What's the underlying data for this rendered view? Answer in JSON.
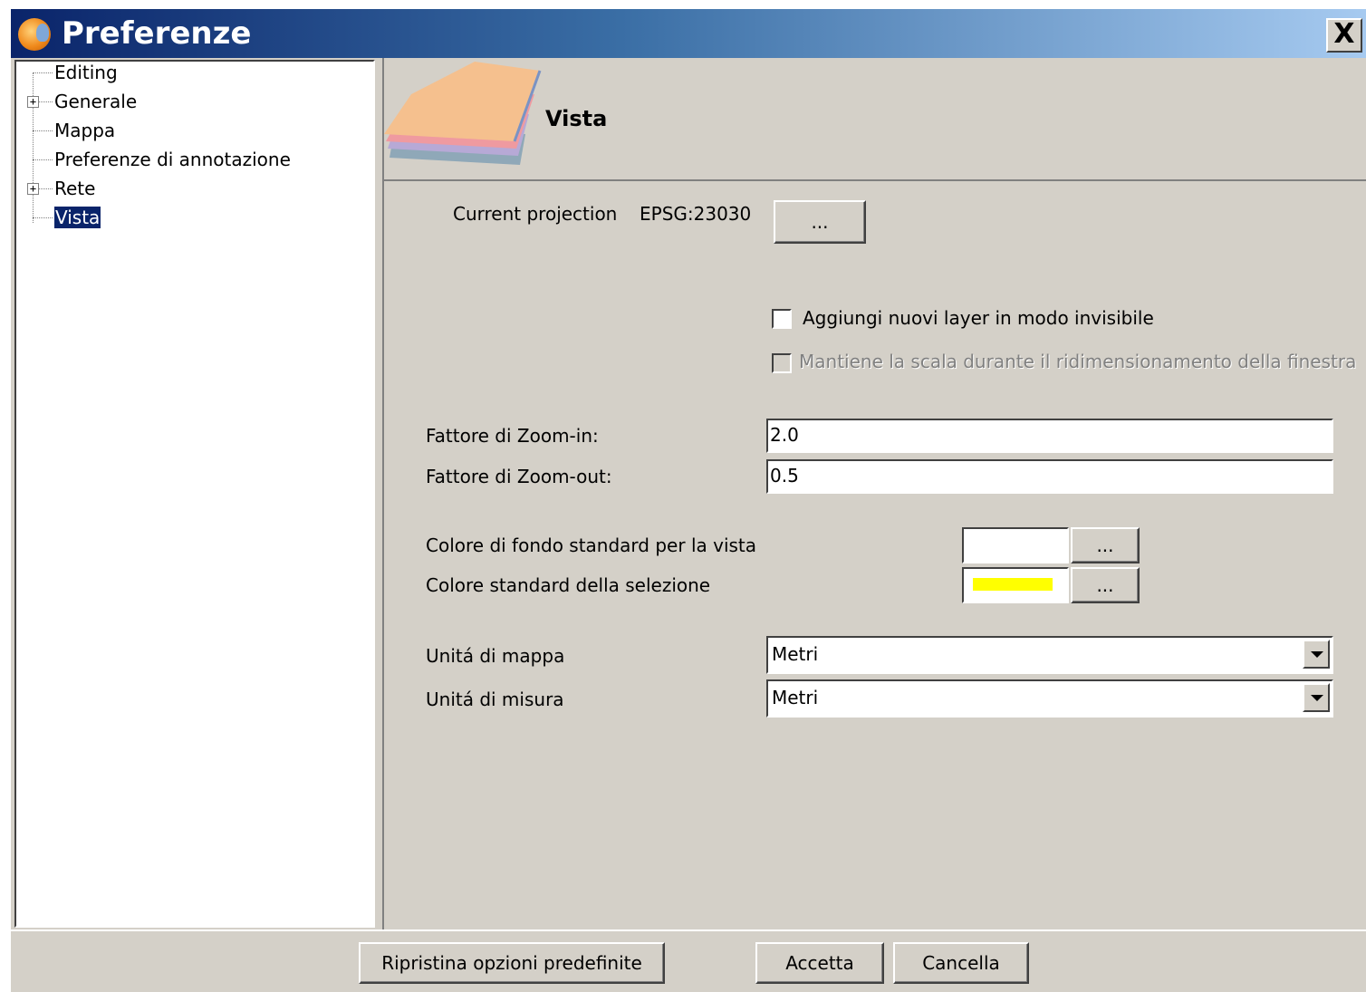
{
  "window": {
    "title": "Preferenze",
    "close_label": "X"
  },
  "tree": {
    "items": [
      {
        "label": "Editing",
        "expandable": false
      },
      {
        "label": "Generale",
        "expandable": true
      },
      {
        "label": "Mappa",
        "expandable": false
      },
      {
        "label": "Preferenze di annotazione",
        "expandable": false
      },
      {
        "label": "Rete",
        "expandable": true
      },
      {
        "label": "Vista",
        "expandable": false,
        "selected": true
      }
    ],
    "expander_symbol": "+"
  },
  "header": {
    "title": "Vista",
    "icon": "layers-icon"
  },
  "projection": {
    "label": "Current projection",
    "value": "EPSG:23030",
    "button_label": "..."
  },
  "checkboxes": {
    "invisible_layers": {
      "label": "Aggiungi nuovi layer in modo invisibile",
      "checked": false,
      "enabled": true
    },
    "keep_scale": {
      "label": "Mantiene la scala durante il ridimensionamento della finestra",
      "checked": false,
      "enabled": false
    }
  },
  "zoom": {
    "in_label": "Fattore di Zoom-in:",
    "in_value": "2.0",
    "out_label": "Fattore di Zoom-out:",
    "out_value": "0.5"
  },
  "colors": {
    "background_label": "Colore di fondo standard per la vista",
    "background_color": "#ffffff",
    "background_button": "...",
    "selection_label": "Colore standard della selezione",
    "selection_color": "#ffff00",
    "selection_button": "..."
  },
  "units": {
    "map_label": "Unitá di mappa",
    "map_value": "Metri",
    "measure_label": "Unitá di misura",
    "measure_value": "Metri"
  },
  "footer": {
    "restore_label": "Ripristina opzioni predefinite",
    "accept_label": "Accetta",
    "cancel_label": "Cancella"
  }
}
